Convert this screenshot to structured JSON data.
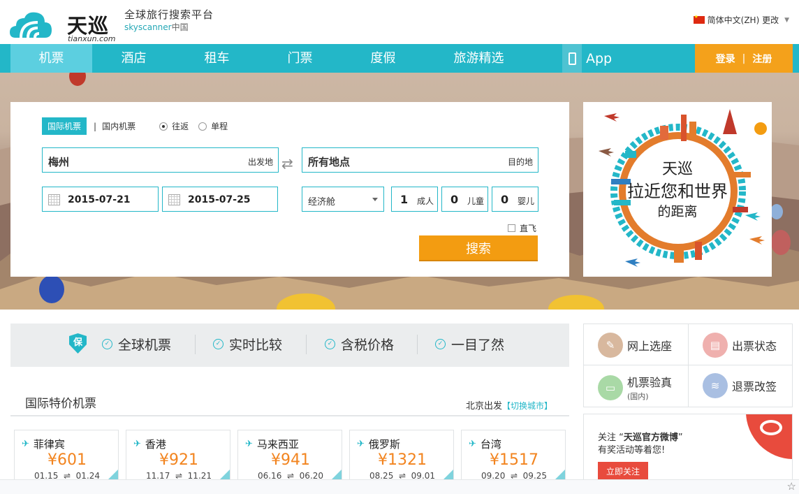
{
  "brand": {
    "logo_text": "天巡",
    "logo_domain": "tianxun.com",
    "tagline": "全球旅行搜索平台",
    "tagline_sub_en": "skyscanner",
    "tagline_sub_cn": "中国"
  },
  "lang": {
    "label": "简体中文(ZH) 更改"
  },
  "nav": {
    "items": [
      "机票",
      "酒店",
      "租车",
      "门票",
      "度假",
      "旅游精选"
    ],
    "active_index": 0,
    "app_label": "App",
    "login": "登录",
    "separator": "|",
    "register": "注册"
  },
  "search": {
    "tab_intl": "国际机票",
    "tab_sep": "|",
    "tab_domestic": "国内机票",
    "trip_round": "往返",
    "trip_oneway": "单程",
    "selected_trip": "往返",
    "origin_value": "梅州",
    "origin_hint": "出发地",
    "dest_value": "所有地点",
    "dest_hint": "目的地",
    "depart_date": "2015-07-21",
    "return_date": "2015-07-25",
    "cabin": "经济舱",
    "adults": "1",
    "adults_label": "成人",
    "children": "0",
    "children_label": "儿童",
    "infants": "0",
    "infants_label": "婴儿",
    "direct_label": "直飞",
    "direct_checked": false,
    "submit": "搜索"
  },
  "hero_ad": {
    "line1": "天巡",
    "line2": "拉近您和世界",
    "line3": "的距离"
  },
  "features": {
    "badge": "保",
    "items": [
      "全球机票",
      "实时比较",
      "含税价格",
      "一目了然"
    ]
  },
  "deals": {
    "title": "国际特价机票",
    "origin_label": "北京出发",
    "switch_label": "【切换城市】",
    "currency": "¥",
    "cards": [
      {
        "dest": "菲律宾",
        "price": "¥601",
        "depart": "01.15",
        "return": "01.24"
      },
      {
        "dest": "香港",
        "price": "¥921",
        "depart": "11.17",
        "return": "11.21"
      },
      {
        "dest": "马来西亚",
        "price": "¥941",
        "depart": "06.16",
        "return": "06.20"
      },
      {
        "dest": "俄罗斯",
        "price": "¥1321",
        "depart": "08.25",
        "return": "09.01"
      },
      {
        "dest": "台湾",
        "price": "¥1517",
        "depart": "09.20",
        "return": "09.25"
      }
    ],
    "date_sep": "⇌"
  },
  "services": [
    {
      "label": "网上选座",
      "sub": "",
      "color": "#d8b89e",
      "icon": "ticket-icon"
    },
    {
      "label": "出票状态",
      "sub": "",
      "color": "#efb0ae",
      "icon": "document-icon"
    },
    {
      "label": "机票验真",
      "sub": "(国内)",
      "color": "#a9d9a6",
      "icon": "monitor-icon"
    },
    {
      "label": "退票改签",
      "sub": "",
      "color": "#a9bfe2",
      "icon": "stack-icon"
    }
  ],
  "weibo": {
    "prefix": "关注 “",
    "name": "天巡官方微博",
    "suffix": "”",
    "line2": "有奖活动等着您!",
    "button": "立即关注"
  },
  "colors": {
    "primary": "#23b7c8",
    "nav_active": "#5ccfe0",
    "accent": "#f39c11",
    "price": "#f2841f",
    "weibo": "#e84b3d"
  }
}
